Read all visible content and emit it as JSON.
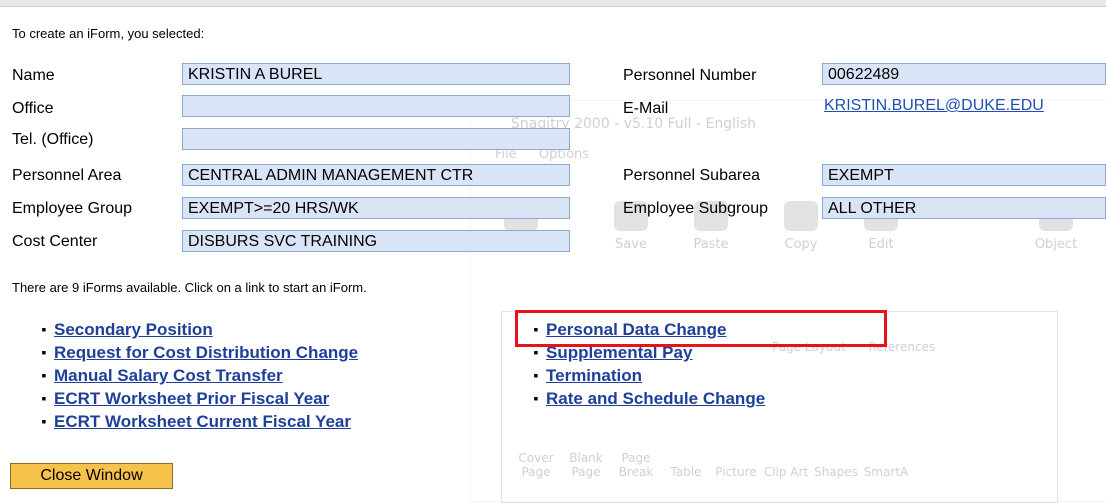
{
  "header": {
    "intro_text": "To create an iForm, you selected:"
  },
  "fields": {
    "name": {
      "label": "Name",
      "value": "KRISTIN A BUREL"
    },
    "office": {
      "label": "Office",
      "value": ""
    },
    "tel_office": {
      "label": "Tel. (Office)",
      "value": ""
    },
    "personnel_area": {
      "label": "Personnel Area",
      "value": "CENTRAL ADMIN MANAGEMENT CTR"
    },
    "employee_group": {
      "label": "Employee Group",
      "value": "EXEMPT>=20 HRS/WK"
    },
    "cost_center": {
      "label": "Cost Center",
      "value": "DISBURS SVC TRAINING"
    },
    "personnel_number": {
      "label": "Personnel Number",
      "value": "00622489"
    },
    "email": {
      "label": "E-Mail",
      "value": "KRISTIN.BUREL@DUKE.EDU"
    },
    "personnel_subarea": {
      "label": "Personnel Subarea",
      "value": "EXEMPT"
    },
    "employee_subgroup": {
      "label": "Employee Subgroup",
      "value": "ALL OTHER"
    }
  },
  "available_text": "There are 9 iForms available. Click on a link to start an iForm.",
  "iforms_left": [
    "Secondary Position",
    "Request for Cost Distribution Change",
    "Manual Salary Cost Transfer",
    "ECRT Worksheet Prior Fiscal Year",
    "ECRT Worksheet Current Fiscal Year"
  ],
  "iforms_right": [
    "Personal Data Change",
    "Supplemental Pay",
    "Termination",
    "Rate and Schedule Change"
  ],
  "bullet_char": "▪",
  "close_button": {
    "label": "Close Window"
  },
  "background_app": {
    "title": "Snagitry 2000 - v5.10 Full - English",
    "menu": [
      "File",
      "Options"
    ],
    "tools": [
      "Load",
      "Save",
      "Paste",
      "Copy",
      "Edit",
      "Object"
    ],
    "ribbon": [
      "Cover Page",
      "Blank Page",
      "Page Break",
      "Table",
      "Picture",
      "Clip Art",
      "Shapes",
      "SmartA"
    ],
    "tabs": [
      "Page Layout",
      "References"
    ]
  },
  "colors": {
    "field_bg": "#d9e5f6",
    "link": "#1f3f99",
    "highlight": "#e8121a",
    "button_bg": "#f7c24c"
  }
}
